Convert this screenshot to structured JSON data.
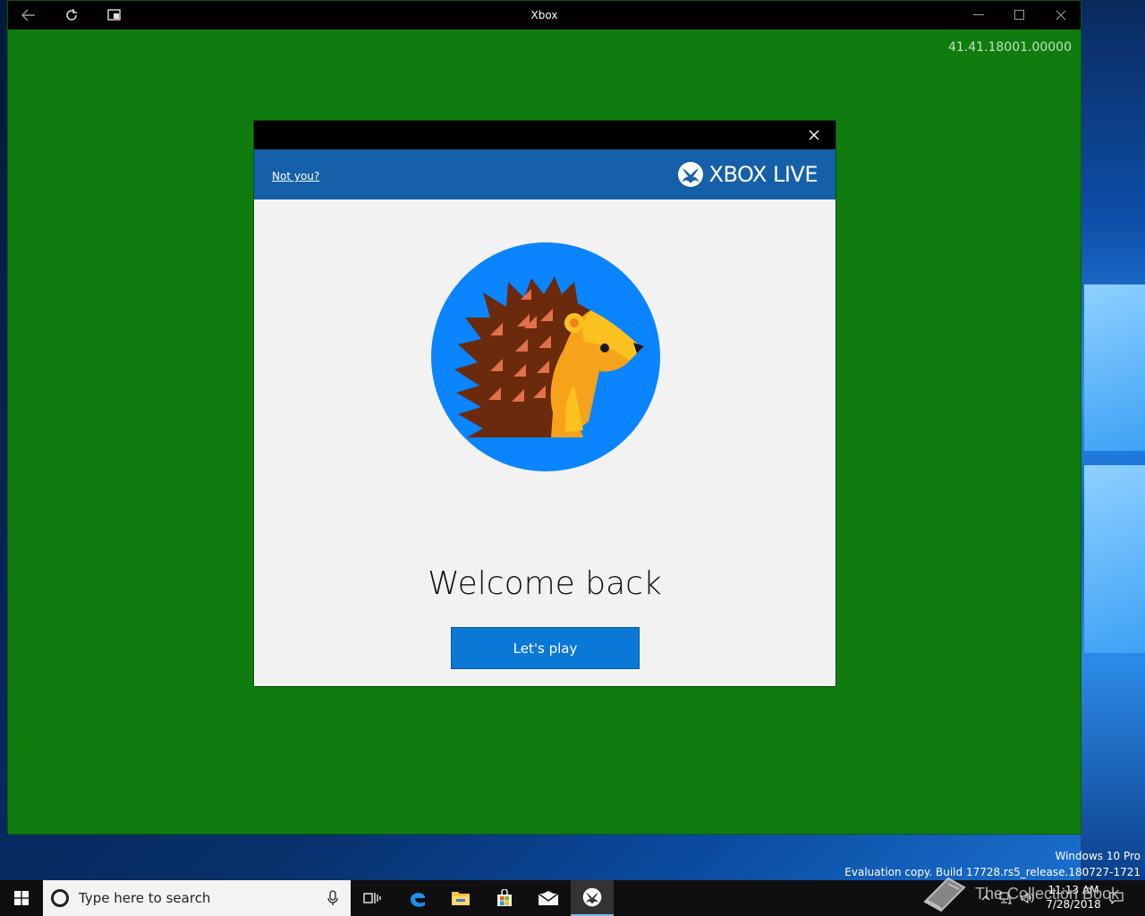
{
  "window": {
    "title": "Xbox",
    "version": "41.41.18001.00000",
    "icons": [
      "back-icon",
      "refresh-icon",
      "compact-overlay-icon",
      "minimize-icon",
      "maximize-icon",
      "close-icon"
    ]
  },
  "dialog": {
    "not_you": "Not you?",
    "brand": "XBOX LIVE",
    "welcome": "Welcome back",
    "play_label": "Let's play",
    "colors": {
      "header": "#1560a8",
      "button": "#0a78d7",
      "avatar_bg": "#0a84ff"
    }
  },
  "watermark": {
    "edition": "Windows 10 Pro",
    "build": "Evaluation copy. Build 17728.rs5_release.180727-1721"
  },
  "taskbar": {
    "search_placeholder": "Type here to search",
    "apps": [
      "task-view-icon",
      "edge-icon",
      "file-explorer-icon",
      "store-icon",
      "mail-icon",
      "xbox-icon"
    ],
    "time": "11:13 AM",
    "date": "7/28/2018"
  },
  "overlay_logo_text": "The Collection Book",
  "colors": {
    "app_bg": "#107c10",
    "taskbar": "#0f0f0f"
  }
}
